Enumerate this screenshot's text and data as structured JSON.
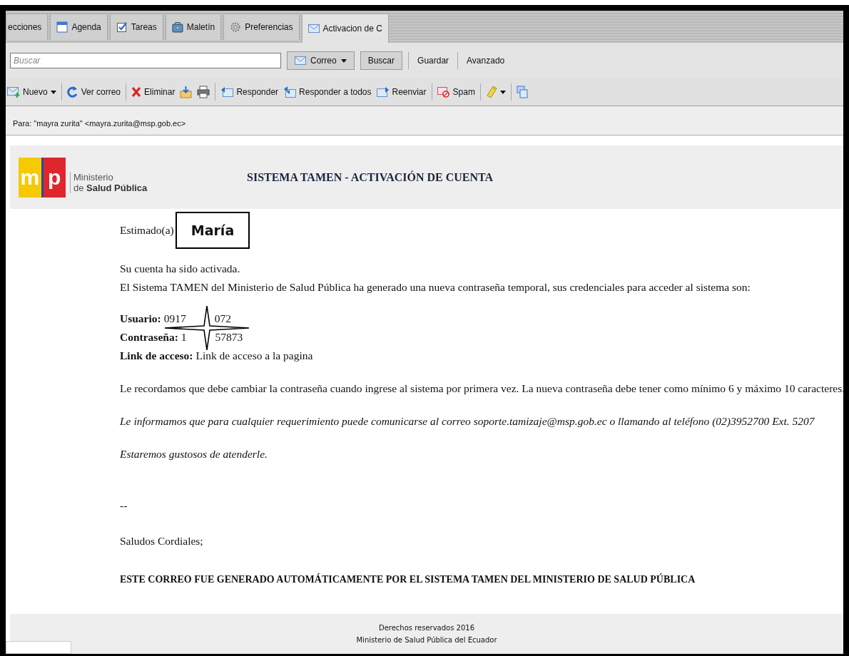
{
  "tabs": [
    {
      "label": "ecciones",
      "kind": "plain",
      "selected": false
    },
    {
      "label": "Agenda",
      "kind": "calendar",
      "selected": false
    },
    {
      "label": "Tareas",
      "kind": "tasks",
      "selected": false
    },
    {
      "label": "Maletín",
      "kind": "briefcase",
      "selected": false
    },
    {
      "label": "Preferencias",
      "kind": "settings",
      "selected": false
    },
    {
      "label": "Activacion de C",
      "kind": "mail",
      "selected": true
    }
  ],
  "search": {
    "placeholder": "Buscar",
    "scope": "Correo",
    "button": "Buscar",
    "links": [
      "Guardar",
      "Avanzado"
    ]
  },
  "toolbar": [
    {
      "kind": "new",
      "label": "Nuevo",
      "dropdown": true
    },
    {
      "kind": "separator"
    },
    {
      "kind": "refresh",
      "label": "Ver correo",
      "dropdown": false
    },
    {
      "kind": "separator"
    },
    {
      "kind": "delete",
      "label": "Eliminar",
      "dropdown": false
    },
    {
      "kind": "archive",
      "dropdown": false
    },
    {
      "kind": "print",
      "dropdown": false
    },
    {
      "kind": "separator"
    },
    {
      "kind": "reply",
      "label": "Responder",
      "dropdown": false
    },
    {
      "kind": "reply-all",
      "label": "Responder a todos",
      "dropdown": false
    },
    {
      "kind": "forward",
      "label": "Reenviar",
      "dropdown": false
    },
    {
      "kind": "separator"
    },
    {
      "kind": "spam",
      "label": "Spam",
      "dropdown": false
    },
    {
      "kind": "separator"
    },
    {
      "kind": "tag",
      "dropdown": true
    },
    {
      "kind": "separator"
    },
    {
      "kind": "window",
      "dropdown": false
    }
  ],
  "message": {
    "to": "Para: \"mayra zurita\" <mayra.zurita@msp.gob.ec>",
    "header": {
      "logo_letters": [
        "m",
        "p"
      ],
      "logo_lines": [
        "Ministerio",
        "de **Salud Pública**"
      ],
      "title": "SISTEMA TAMEN - ACTIVACIÓN DE CUENTA"
    },
    "greeting": "Estimado(a)",
    "name_box": "María",
    "intro": [
      "Su cuenta ha sido activada.",
      "El Sistema TAMEN del Ministerio de Salud Pública ha generado una nueva contraseña temporal, sus credenciales para acceder al sistema son:"
    ],
    "credentials": [
      {
        "label": "Usuario:",
        "value_parts": [
          "0917",
          "072"
        ]
      },
      {
        "label": "Contraseña:",
        "value_parts": [
          "1",
          "57873"
        ]
      },
      {
        "label": "Link de acceso:",
        "value_parts": [
          "Link de acceso a la pagina"
        ]
      }
    ],
    "paragraphs": [
      {
        "kind": "normal",
        "text": "Le recordamos que debe cambiar la contraseña cuando ingrese al sistema por primera vez. La nueva contraseña debe tener como mínimo 6 y máximo 10 caracteres."
      },
      {
        "kind": "italic",
        "text": "Le informamos que para cualquier requerimiento puede comunicarse al correo soporte.tamizaje@msp.gob.ec o llamando al teléfono (02)3952700 Ext. 5207"
      },
      {
        "kind": "italic",
        "text": "Estaremos gustosos de atenderle."
      }
    ],
    "signature": [
      "--",
      "Saludos Cordiales;"
    ],
    "notice": "ESTE CORREO FUE GENERADO AUTOMÁTICAMENTE POR EL SISTEMA TAMEN DEL MINISTERIO DE SALUD PÚBLICA",
    "footer": [
      "Derechos reservados 2016",
      "Ministerio de Salud Pública del Ecuador"
    ]
  }
}
